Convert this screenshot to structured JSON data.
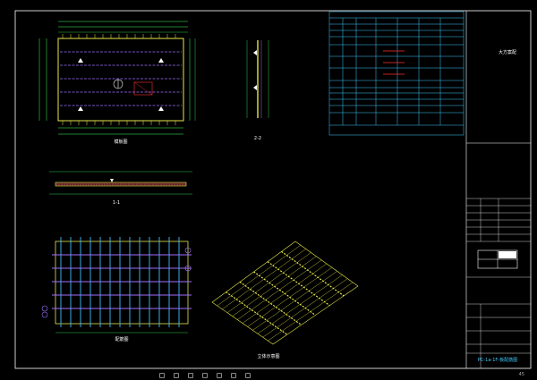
{
  "views": {
    "plan_label": "模板图",
    "elevation_label": "1-1",
    "section_label": "2-2",
    "rebar_label": "配筋图",
    "iso_label": "立体示意图"
  },
  "title_block": {
    "side_text": "大方案配",
    "drawing_name": "PC-1a-1F-板配筋图"
  },
  "colors": {
    "frame": "#ffffff",
    "panel_outline": "#e8e84a",
    "rebar_purple": "#a070ff",
    "rebar_cyan": "#40c0ff",
    "dim_green": "#40ff60",
    "table_cyan": "#3fc9ff",
    "hatch_red": "#ff3030"
  },
  "taskbar": {
    "items": [
      "",
      "",
      "",
      "",
      "",
      "",
      ""
    ],
    "page_number": "45"
  }
}
